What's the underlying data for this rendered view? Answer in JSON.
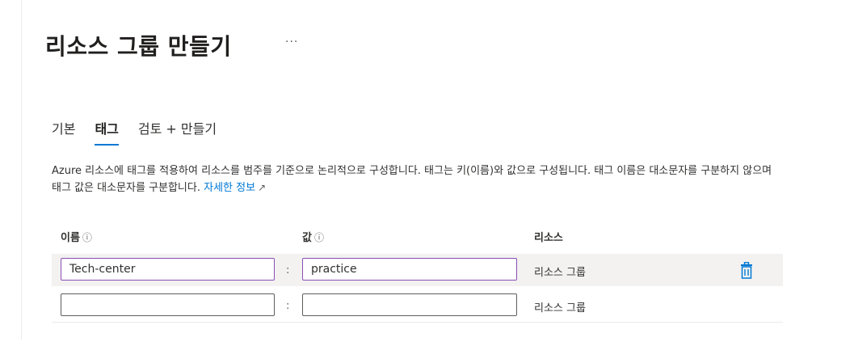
{
  "page": {
    "title": "리소스 그룹 만들기",
    "more": "···"
  },
  "tabs": [
    {
      "label": "기본"
    },
    {
      "label": "태그"
    },
    {
      "label": "검토 + 만들기"
    }
  ],
  "description": {
    "text": "Azure 리소스에 태그를 적용하여 리소스를 범주를 기준으로 논리적으로 구성합니다. 태그는 키(이름)와 값으로 구성됩니다. 태그 이름은 대소문자를 구분하지 않으며 태그 값은 대소문자를 구분합니다.",
    "link": "자세한 정보",
    "link_icon": "↗"
  },
  "columns": {
    "name": "이름",
    "value": "값",
    "resource": "리소스",
    "info_icon": "ⓘ"
  },
  "rows": [
    {
      "name": "Tech-center",
      "value": "practice",
      "separator": ":",
      "resource": "리소스 그룹"
    },
    {
      "name": "",
      "value": "",
      "separator": ":",
      "resource": "리소스 그룹"
    }
  ],
  "colors": {
    "accent": "#0078d4",
    "focus_border": "#8a4eb6",
    "row_highlight": "#f3f2f1"
  }
}
